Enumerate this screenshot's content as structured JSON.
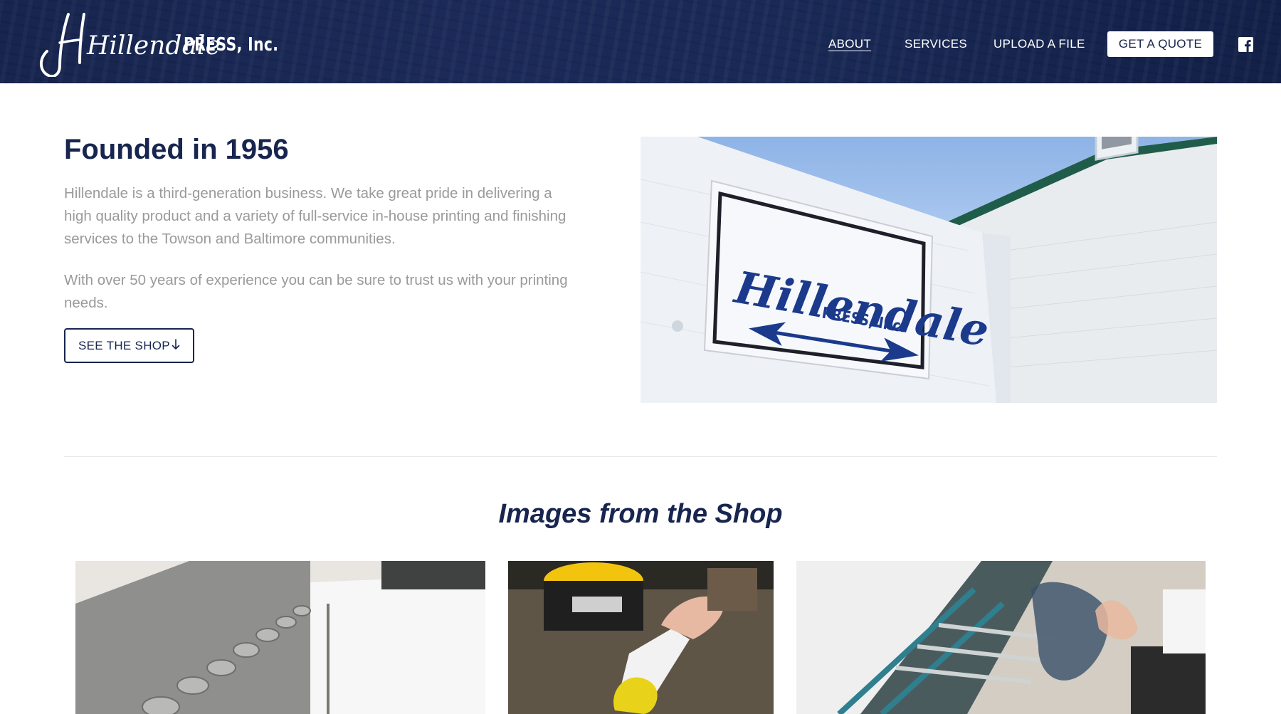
{
  "header": {
    "logo": {
      "script_text": "Hillendale",
      "suffix_text": "PRESS, Inc."
    },
    "nav": {
      "items": [
        {
          "label": "ABOUT",
          "active": true
        },
        {
          "label": "SERVICES",
          "active": false
        },
        {
          "label": "UPLOAD A FILE",
          "active": false
        }
      ],
      "cta_label": "GET A QUOTE",
      "social_icon": "facebook-icon"
    }
  },
  "about": {
    "title": "Founded in 1956",
    "paragraph_1": "Hillendale is a third-generation business. We take great pride in delivering a high quality product and a variety of full-service in-house printing and finishing services to the Towson and Baltimore communities.",
    "paragraph_2": "With over 50 years of experience you can be sure to trust us with your printing needs.",
    "button_label": "SEE THE SHOP",
    "button_icon": "arrow-down-icon",
    "image": {
      "sign_script_text": "Hillendale",
      "sign_suffix_text": "PRESS, Inc."
    }
  },
  "gallery": {
    "title": "Images from the Shop"
  },
  "colors": {
    "navy": "#17254f",
    "body_text": "#9a9a9a",
    "divider": "#e6e6e6",
    "white": "#ffffff"
  }
}
